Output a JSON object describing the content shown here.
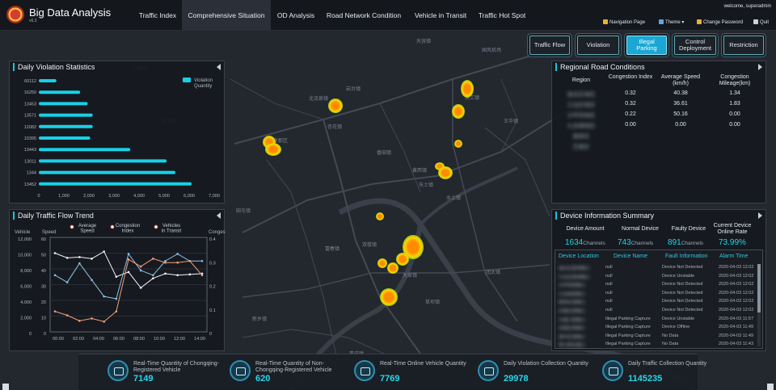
{
  "header": {
    "title": "Big Data Analysis",
    "version": "v6.3",
    "tabs": [
      "Traffic Index",
      "Comprehensive Situation",
      "OD Analysis",
      "Road Network Condition",
      "Vehicle in Transit",
      "Traffic Hot Spot"
    ],
    "active_tab": 1,
    "welcome": "welcome,   superadmin",
    "tools": [
      "Navigation Page",
      "Theme",
      "Change Password",
      "Quit"
    ]
  },
  "categories": [
    {
      "label": "Traffic Flow"
    },
    {
      "label": "Violation"
    },
    {
      "label": "Illegal Parking",
      "active": true
    },
    {
      "label": "Control Deployment"
    },
    {
      "label": "Restriction"
    }
  ],
  "map_labels": [
    "天容镇",
    "国风机场",
    "六琢镇",
    "东平镇",
    "北流泉镇",
    "岩台镇",
    "龙郡区",
    "杏花镇",
    "灵工镇",
    "王华镇",
    "香田镇",
    "黄西镇",
    "东土镇",
    "水土镇",
    "双楼镇",
    "大家镇",
    "草坝镇",
    "团太镇",
    "富春镇",
    "田屯镇",
    "新乡镇",
    "重庆镇",
    "石盘镇"
  ],
  "violation": {
    "title": "Daily Violation Statistics",
    "legend": "Violation Quantity",
    "color": "#19d0e6",
    "chart_data": {
      "type": "bar",
      "orientation": "horizontal",
      "categories": [
        "60112",
        "16250",
        "13453",
        "13571",
        "12082",
        "10395",
        "13443",
        "13011",
        "1344",
        "13452"
      ],
      "values": [
        700,
        1650,
        1950,
        2150,
        2150,
        2050,
        3650,
        5100,
        5450,
        6100
      ],
      "xlim": [
        0,
        7000
      ],
      "xticks": [
        "0",
        "1,000",
        "2,000",
        "3,000",
        "4,000",
        "5,000",
        "6,000",
        "7,000"
      ]
    }
  },
  "flow": {
    "title": "Daily Traffic Flow Trend",
    "axis_left1": "Vehicle",
    "axis_left2": "Speed",
    "axis_right": "Congestion",
    "legend": [
      "Average Speed",
      "Congestion Index",
      "Vehicles in Transit"
    ],
    "chart_data": {
      "type": "line",
      "x": [
        "00:00",
        "02:00",
        "04:00",
        "06:00",
        "08:00",
        "10:00",
        "12:00",
        "14:00"
      ],
      "vehicle_ticks": [
        "12,000",
        "10,000",
        "8,000",
        "6,000",
        "4,000",
        "2,000",
        "0"
      ],
      "speed_ticks": [
        "60",
        "50",
        "40",
        "30",
        "20",
        "10",
        "0"
      ],
      "congestion_ticks": [
        "0.4",
        "0.3",
        "0.2",
        "0.1",
        "0"
      ],
      "series": [
        {
          "name": "Average Speed",
          "color": "#f0f4f8",
          "values": [
            50,
            47,
            47.5,
            46.5,
            51,
            35,
            38,
            28,
            34,
            37,
            36,
            36.5,
            37
          ]
        },
        {
          "name": "Congestion Index",
          "color": "#8fc1e3",
          "values": [
            0.24,
            0.21,
            0.29,
            0.22,
            0.15,
            0.14,
            0.33,
            0.26,
            0.24,
            0.3,
            0.33,
            0.3,
            0.3
          ]
        },
        {
          "name": "Vehicles in Transit",
          "color": "#f2a07a",
          "values": [
            2600,
            2100,
            1400,
            1700,
            1300,
            2600,
            9200,
            8300,
            9300,
            8800,
            8800,
            9000,
            7200
          ]
        }
      ]
    }
  },
  "regional": {
    "title": "Regional Road Conditions",
    "headers": [
      "Region",
      "Congestion Index",
      "Average Speed (km/h)",
      "Congestion Mileage(km)"
    ],
    "rows": [
      [
        "渝北区地区",
        "0.32",
        "40.38",
        "1.34"
      ],
      [
        "江北区地区",
        "0.32",
        "36.61",
        "1.83"
      ],
      [
        "沙坪坝地区",
        "0.22",
        "50.16",
        "0.00"
      ],
      [
        "九龙坡地区",
        "0.00",
        "0.00",
        "0.00"
      ],
      [
        "南岸区",
        "",
        "",
        ""
      ],
      [
        "巴南区",
        "",
        "",
        ""
      ]
    ]
  },
  "device": {
    "title": "Device Information Summary",
    "labels": [
      "Device Amount",
      "Normal Device",
      "Faulty Device",
      "Current Device Online Rate"
    ],
    "values": [
      "1634",
      "743",
      "891",
      "73.99%"
    ],
    "unit": "Channels",
    "table_headers": [
      "Device Location",
      "Device Name",
      "Fault Information",
      "Alarm Time"
    ],
    "rows": [
      [
        "渝北区某某路口",
        "null",
        "Device Not Detected",
        "2020-04-03 12:02"
      ],
      [
        "江北区某某路口",
        "null",
        "Device Unstable",
        "2020-04-03 12:02"
      ],
      [
        "沙坪坝某路口",
        "null",
        "Device Not Detected",
        "2020-04-03 12:02"
      ],
      [
        "九龙坡某路口",
        "null",
        "Device Not Detected",
        "2020-04-03 12:02"
      ],
      [
        "南岸区某路口",
        "null",
        "Device Not Detected",
        "2020-04-03 12:02"
      ],
      [
        "巴南区某路口",
        "null",
        "Device Not Detected",
        "2020-04-03 12:02"
      ],
      [
        "大渡口某路口",
        "Illegal Parking Capture",
        "Device Unstable",
        "2020-04-03 11:57"
      ],
      [
        "北碚区某路口",
        "Illegal Parking Capture",
        "Device Offline",
        "2020-04-03 11:49"
      ],
      [
        "渝中区某路口",
        "Illegal Parking Capture",
        "No Data",
        "2020-04-03 11:49"
      ],
      [
        "两江新区路口",
        "Illegal Parking Capture",
        "No Data",
        "2020-04-03 11:43"
      ]
    ]
  },
  "stats": [
    {
      "label": "Real-Time Quantity of Chongqing-Registered Vehicle",
      "value": "7149",
      "icon": "car-icon"
    },
    {
      "label": "Real-Time Quantity of Non-Chongqing-Registered Vehicle",
      "value": "620",
      "icon": "car-icon"
    },
    {
      "label": "Real-Time Online Vehicle Quantity",
      "value": "7769",
      "icon": "vehicle-online-icon"
    },
    {
      "label": "Daily Violation Collection Quantity",
      "value": "29978",
      "icon": "camera-icon"
    },
    {
      "label": "Daily Traffic Collection Quantity",
      "value": "1145235",
      "icon": "camera-icon"
    }
  ]
}
